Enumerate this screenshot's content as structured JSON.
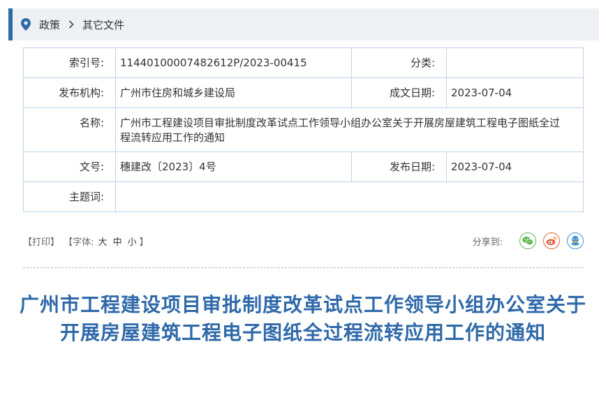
{
  "breadcrumb": {
    "items": [
      "政策",
      "其它文件"
    ],
    "separator": ">"
  },
  "info": {
    "index_label": "索引号:",
    "index_value": "11440100007482612P/2023-00415",
    "category_label": "分类:",
    "category_value": "",
    "publisher_label": "发布机构:",
    "publisher_value": "广州市住房和城乡建设局",
    "written_date_label": "成文日期:",
    "written_date_value": "2023-07-04",
    "name_label": "名称:",
    "name_value": "广州市工程建设项目审批制度改革试点工作领导小组办公室关于开展房屋建筑工程电子图纸全过程流转应用工作的通知",
    "doc_no_label": "文号:",
    "doc_no_value": "穗建改〔2023〕4号",
    "publish_date_label": "发布日期:",
    "publish_date_value": "2023-07-04",
    "subject_label": "主题词:",
    "subject_value": ""
  },
  "tools": {
    "print": "【打印】",
    "font_prefix": "【字体:",
    "font_large": "大",
    "font_medium": "中",
    "font_small": "小",
    "font_suffix": "】",
    "share_label": "分享到:"
  },
  "icons": {
    "wechat": "wechat-icon",
    "weibo": "weibo-icon",
    "qq": "qq-icon"
  },
  "colors": {
    "accent": "#2f69a9",
    "border": "#bfd3e8",
    "breadcrumb_bg": "#eef0f3"
  },
  "article": {
    "title": "广州市工程建设项目审批制度改革试点工作领导小组办公室关于开展房屋建筑工程电子图纸全过程流转应用工作的通知"
  }
}
